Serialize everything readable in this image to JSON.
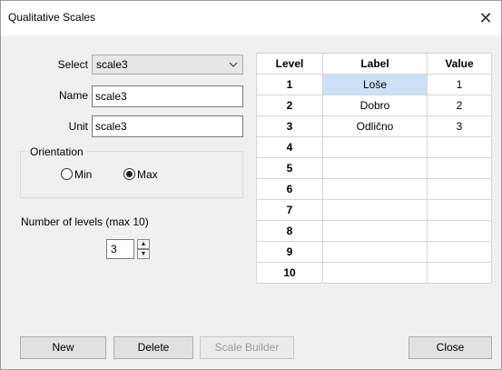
{
  "window": {
    "title": "Qualitative Scales",
    "close_glyph": "✕"
  },
  "form": {
    "select_label": "Select",
    "select_value": "scale3",
    "name_label": "Name",
    "name_value": "scale3",
    "unit_label": "Unit",
    "unit_value": "scale3"
  },
  "orientation": {
    "title": "Orientation",
    "options": [
      {
        "label": "Min",
        "checked": false
      },
      {
        "label": "Max",
        "checked": true
      }
    ]
  },
  "levels_control": {
    "label": "Number of levels (max 10)",
    "value": "3",
    "up": "▲",
    "down": "▼"
  },
  "table": {
    "headers": [
      "Level",
      "Label",
      "Value"
    ],
    "rows": [
      {
        "level": "1",
        "label": "Loše",
        "value": "1"
      },
      {
        "level": "2",
        "label": "Dobro",
        "value": "2"
      },
      {
        "level": "3",
        "label": "Odlično",
        "value": "3"
      },
      {
        "level": "4",
        "label": "",
        "value": ""
      },
      {
        "level": "5",
        "label": "",
        "value": ""
      },
      {
        "level": "6",
        "label": "",
        "value": ""
      },
      {
        "level": "7",
        "label": "",
        "value": ""
      },
      {
        "level": "8",
        "label": "",
        "value": ""
      },
      {
        "level": "9",
        "label": "",
        "value": ""
      },
      {
        "level": "10",
        "label": "",
        "value": ""
      }
    ]
  },
  "buttons": {
    "new": "New",
    "delete": "Delete",
    "scale_builder": "Scale Builder",
    "close": "Close"
  }
}
